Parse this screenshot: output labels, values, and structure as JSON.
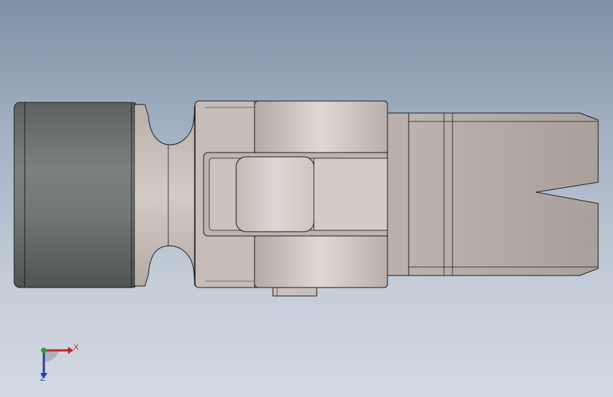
{
  "viewport": {
    "background_top": "#7f91a6",
    "background_bottom": "#d3d9e2"
  },
  "model": {
    "part_color": "#c9bfba",
    "cylinder_color": "#6f7574",
    "edge_color": "#1a1a1a"
  },
  "triad": {
    "x_label": "X",
    "z_label": "Z",
    "x_color": "#c0262b",
    "y_color": "#22a23c",
    "z_color": "#2a3aa8"
  }
}
